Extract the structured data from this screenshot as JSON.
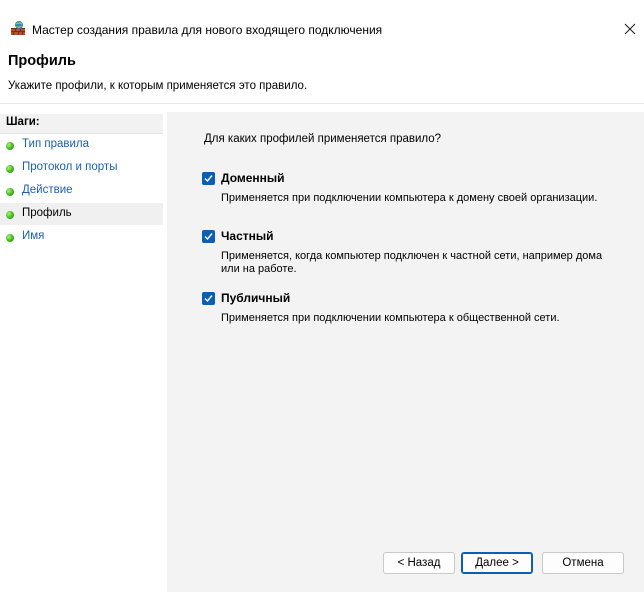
{
  "window": {
    "title": "Мастер создания правила для нового входящего подключения",
    "icon": "firewall-icon"
  },
  "header": {
    "title": "Профиль",
    "subtitle": "Укажите профили, к которым применяется это правило."
  },
  "steps": {
    "header": "Шаги:",
    "items": [
      {
        "label": "Тип правила",
        "current": false
      },
      {
        "label": "Протокол и порты",
        "current": false
      },
      {
        "label": "Действие",
        "current": false
      },
      {
        "label": "Профиль",
        "current": true
      },
      {
        "label": "Имя",
        "current": false
      }
    ]
  },
  "content": {
    "question": "Для каких профилей применяется правило?",
    "profiles": [
      {
        "name": "Доменный",
        "checked": true,
        "description": "Применяется при подключении компьютера к домену своей организации."
      },
      {
        "name": "Частный",
        "checked": true,
        "description": "Применяется, когда компьютер подключен к частной сети, например дома или на работе."
      },
      {
        "name": "Публичный",
        "checked": true,
        "description": "Применяется при подключении компьютера к общественной сети."
      }
    ]
  },
  "buttons": {
    "back": "< Назад",
    "next": "Далее >",
    "cancel": "Отмена"
  },
  "colors": {
    "accent": "#0a5fb4",
    "link": "#1a5fb4",
    "step_dot": "#3fb81a",
    "pane_bg": "#f3f3f3"
  }
}
